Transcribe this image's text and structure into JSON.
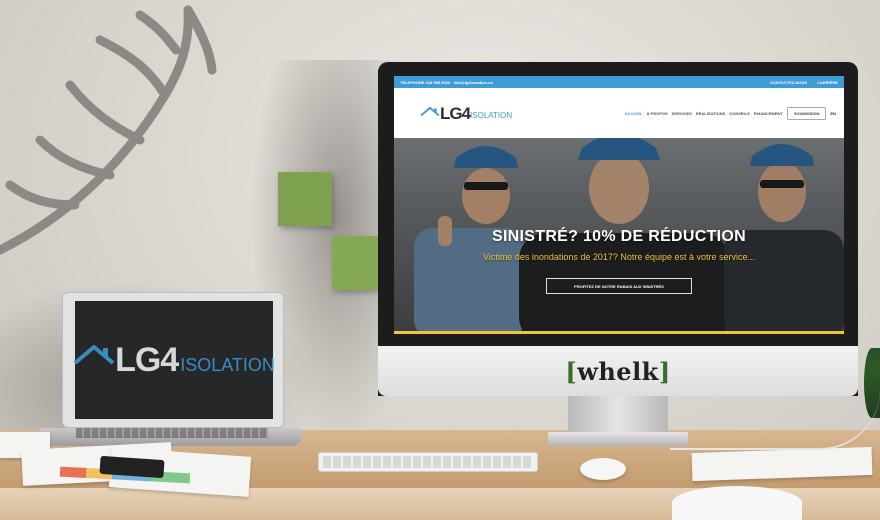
{
  "laptop": {
    "logo_main": "LG4",
    "logo_sub": "ISOLATION"
  },
  "imac": {
    "brand": "whelk"
  },
  "website": {
    "topbar": {
      "contact": "TELEPHONE 418 555 0000 · info@lg4isolation.ca",
      "links": [
        "CONTACTEZ-NOUS",
        "CARRIÈRE"
      ]
    },
    "logo": {
      "main": "LG4",
      "sub": "ISOLATION"
    },
    "nav": {
      "items": [
        "ACCUEIL",
        "À PROPOS",
        "SERVICES",
        "RÉALISATIONS",
        "CONSEILS",
        "FINANCEMENT"
      ],
      "active_index": 0,
      "cta": "SOUMISSION",
      "lang": "EN"
    },
    "hero": {
      "title": "SINISTRÉ? 10% DE RÉDUCTION",
      "subtitle": "Victime des inondations de 2017? Notre équipe est à votre service...",
      "button": "PROFITEZ DE NOTRE RABAIS AUX SINISTRÉS"
    }
  },
  "colors": {
    "accent_blue": "#3d9bd6",
    "accent_yellow": "#f0c33a",
    "sticky_note_green": "#7ea24f"
  }
}
